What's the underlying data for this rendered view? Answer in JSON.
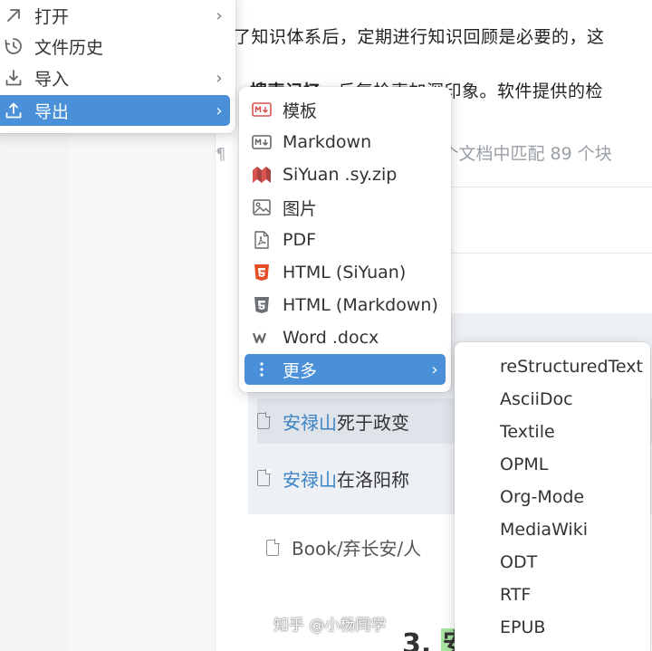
{
  "editor": {
    "para1": "了知识体系后，定期进行知识回顾是必要的，这",
    "para2_strong": "搜索记忆",
    "para2_rest": "，反复检索加深印象。软件提供的检",
    "search_info": "个文档中匹配 89 个块",
    "results": [
      {
        "highlight": "安禄山",
        "text": "死于政变"
      },
      {
        "highlight": "安禄山",
        "text": "在洛阳称"
      }
    ],
    "book_path": "Book/弃长安/人",
    "heading_number": "3.",
    "heading_mark": "安"
  },
  "watermark": "知乎 @小杨同学",
  "file_menu": {
    "items": [
      {
        "label": "打开",
        "icon": "arrow-up-right-icon",
        "submenu": true
      },
      {
        "label": "文件历史",
        "icon": "history-icon",
        "submenu": false
      },
      {
        "label": "导入",
        "icon": "import-icon",
        "submenu": true
      },
      {
        "label": "导出",
        "icon": "export-icon",
        "submenu": true,
        "active": true
      }
    ]
  },
  "export_menu": {
    "items": [
      {
        "label": "模板",
        "icon": "markdown-template-icon"
      },
      {
        "label": "Markdown",
        "icon": "markdown-icon"
      },
      {
        "label": "SiYuan .sy.zip",
        "icon": "siyuan-icon"
      },
      {
        "label": "图片",
        "icon": "image-icon"
      },
      {
        "label": "PDF",
        "icon": "pdf-icon"
      },
      {
        "label": "HTML (SiYuan)",
        "icon": "html5-icon"
      },
      {
        "label": "HTML (Markdown)",
        "icon": "html5-grey-icon"
      },
      {
        "label": "Word .docx",
        "icon": "word-icon"
      },
      {
        "label": "更多",
        "icon": "more-vertical-icon",
        "active": true
      }
    ]
  },
  "more_menu": {
    "items": [
      "reStructuredText",
      "AsciiDoc",
      "Textile",
      "OPML",
      "Org-Mode",
      "MediaWiki",
      "ODT",
      "RTF",
      "EPUB"
    ]
  },
  "colors": {
    "accent": "#4a90d9",
    "highlight_text": "#3b82c4",
    "heading_mark": "#a6e3a0",
    "html5_icon": "#e44d26"
  }
}
